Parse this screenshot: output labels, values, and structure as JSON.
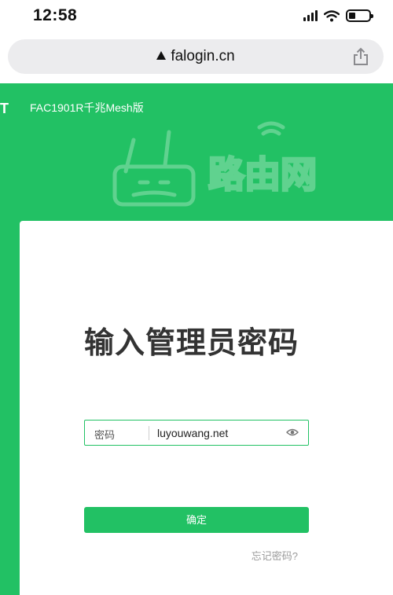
{
  "status_bar": {
    "time": "12:58",
    "icons": [
      "cellular-signal-icon",
      "wifi-icon",
      "battery-icon"
    ]
  },
  "browser": {
    "url": "falogin.cn",
    "security_icon": "warning-triangle-icon",
    "share_icon": "share-icon"
  },
  "header": {
    "logo_text": "T",
    "model": "FAC1901R千兆Mesh版",
    "watermark_text": "路由网"
  },
  "login": {
    "title": "输入管理员密码",
    "password_label": "密码",
    "password_value": "luyouwang.net",
    "show_password_icon": "eye-icon",
    "confirm_label": "确定",
    "forgot_label": "忘记密码?"
  },
  "colors": {
    "brand_green": "#22c164",
    "card_bg": "#ffffff",
    "address_bar_bg": "#ececee"
  }
}
